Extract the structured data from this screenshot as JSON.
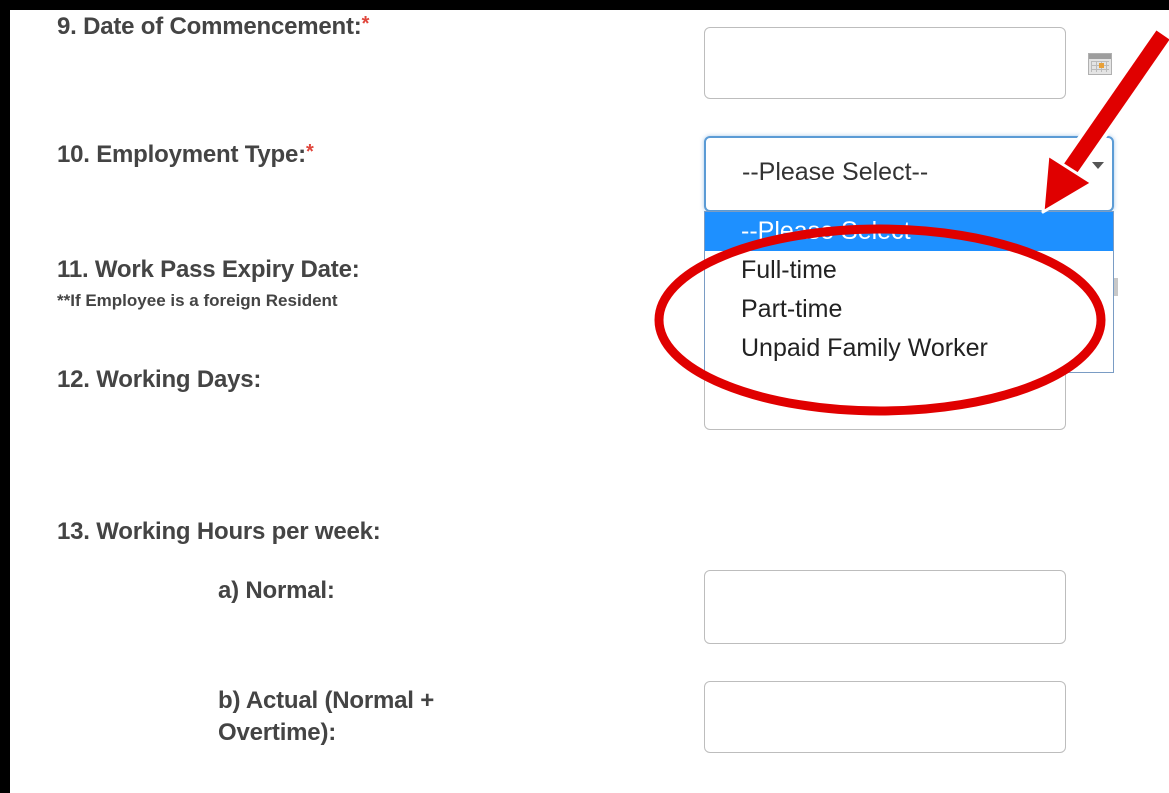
{
  "required_mark": "*",
  "fields": {
    "commencement": {
      "label": "9. Date of Commencement:",
      "value": ""
    },
    "employment_type": {
      "label": "10. Employment Type:",
      "selected": "--Please Select--",
      "options": [
        "--Please Select--",
        "Full-time",
        "Part-time",
        "Unpaid Family Worker"
      ]
    },
    "work_pass": {
      "label": "11. Work Pass Expiry Date:",
      "note": "**If Employee is a foreign Resident"
    },
    "working_days": {
      "label": "12. Working Days:",
      "value": ""
    },
    "working_hours": {
      "label": "13. Working Hours per week:",
      "normal_label": "a) Normal:",
      "normal_value": "",
      "actual_label_line1": "b) Actual (Normal +",
      "actual_label_line2": "Overtime):",
      "actual_value": ""
    }
  },
  "icons": {
    "calendar": "calendar-icon"
  },
  "annotation": {
    "color": "#e00000"
  }
}
